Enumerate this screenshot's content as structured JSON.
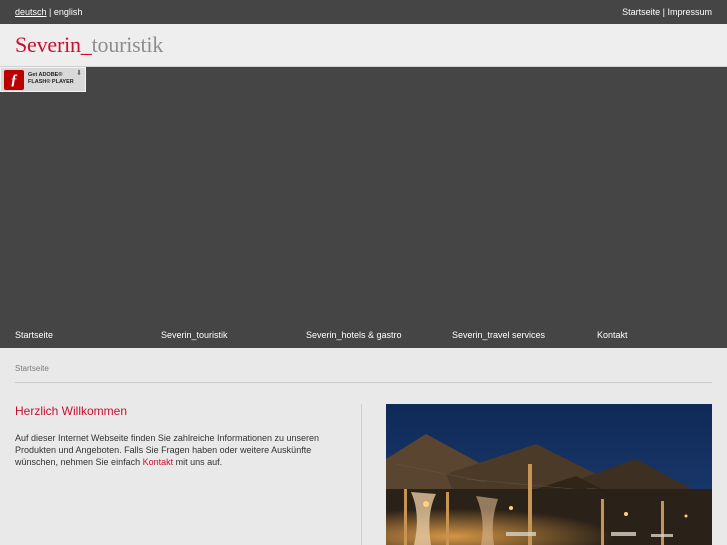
{
  "topbar": {
    "lang_active": "deutsch",
    "lang_separator": " | ",
    "lang_other": "english",
    "utility_home": "Startseite",
    "utility_separator": " | ",
    "utility_imprint": "Impressum"
  },
  "header": {
    "logo_part1": "Severin_",
    "logo_part2": "touristik"
  },
  "flash_badge": {
    "line1": "Get ADOBE®",
    "line2": "FLASH® PLAYER",
    "icon": "flash-icon"
  },
  "nav": {
    "items": [
      {
        "label": "Startseite"
      },
      {
        "label": "Severin_touristik"
      },
      {
        "label": "Severin_hotels & gastro"
      },
      {
        "label": "Severin_travel services"
      },
      {
        "label": "Kontakt"
      }
    ]
  },
  "breadcrumb": "Startseite",
  "main": {
    "heading": "Herzlich Willkommen",
    "text_before": "Auf dieser Internet Webseite finden Sie zahlreiche Informationen zu unseren Produkten und Angeboten. Falls Sie Fragen haben oder weitere Auskünfte wünschen, nehmen Sie einfach ",
    "link": "Kontakt",
    "text_after": " mit uns auf."
  },
  "colors": {
    "accent": "#c8102e",
    "dark_bar": "#454545",
    "page_bg": "#e9e9e9"
  }
}
